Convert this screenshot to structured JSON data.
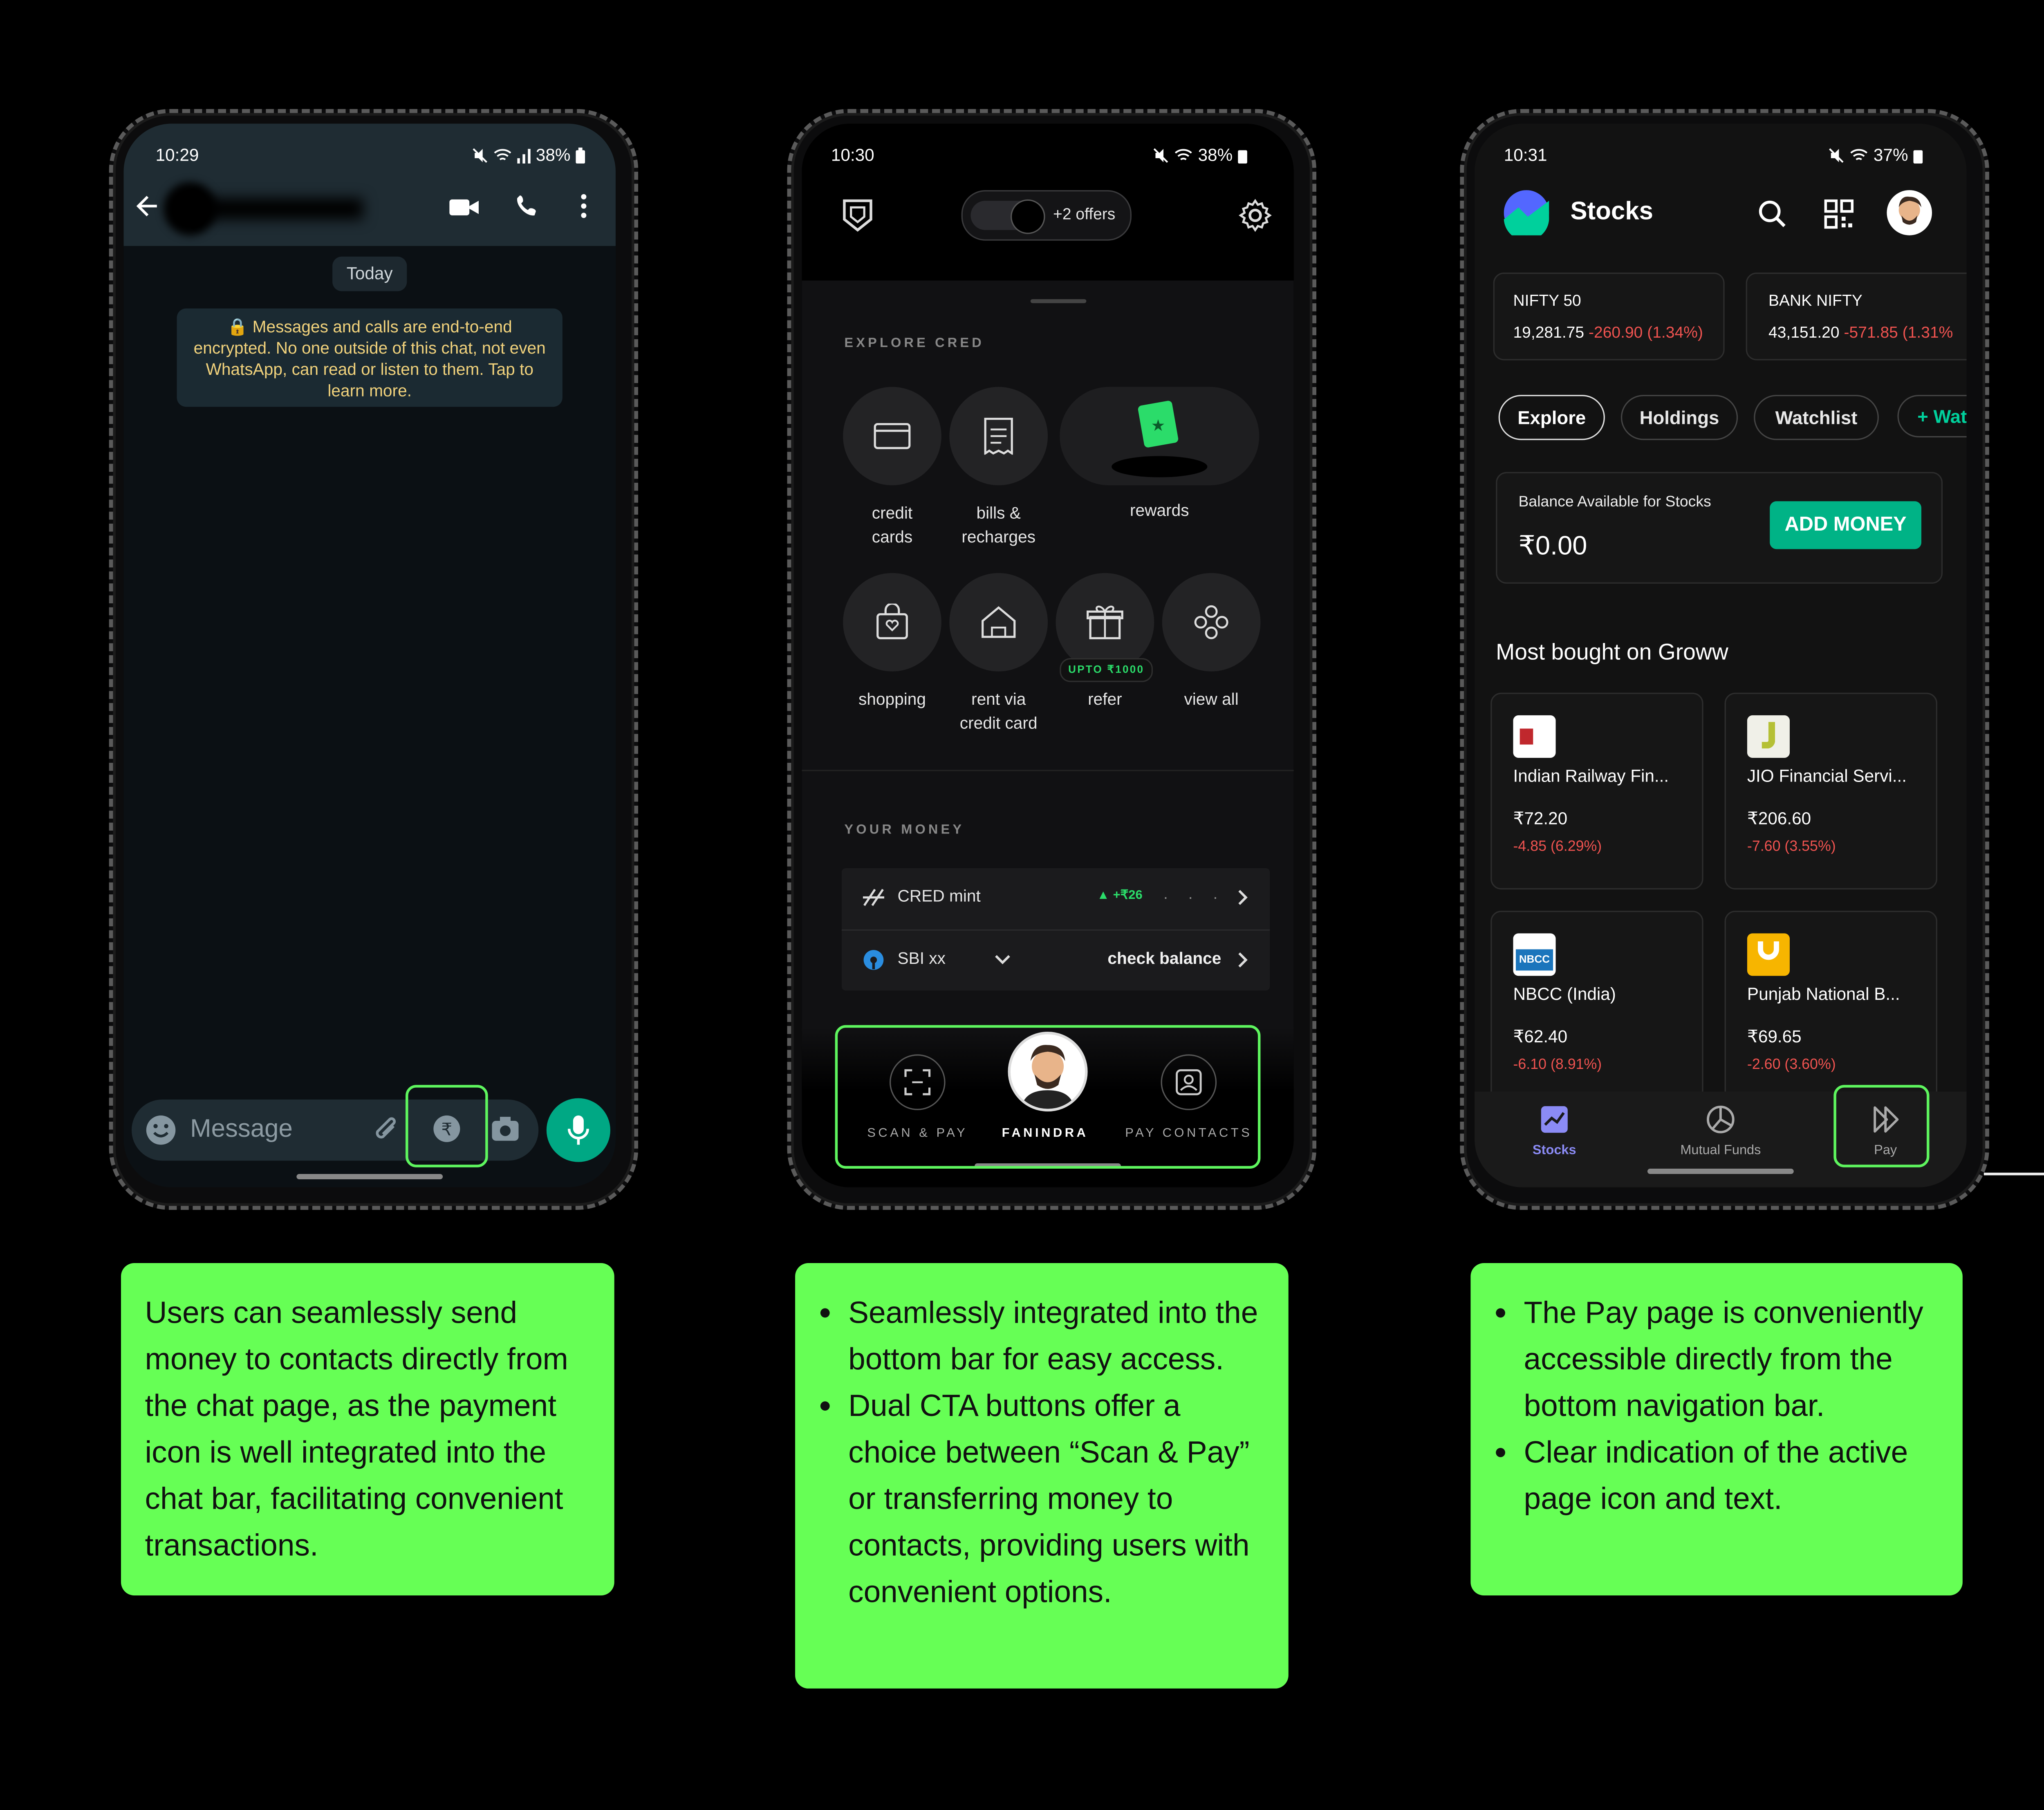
{
  "whatsapp": {
    "time": "10:29",
    "battery": "38%",
    "date_chip": "Today",
    "encryption_notice": "🔒 Messages and calls are end-to-end encrypted. No one outside of this chat, not even WhatsApp, can read or listen to them. Tap to learn more.",
    "message_placeholder": "Message",
    "icons": [
      "back-arrow-icon",
      "video-call-icon",
      "phone-icon",
      "more-vertical-icon",
      "emoji-icon",
      "attach-icon",
      "rupee-icon",
      "camera-icon",
      "mic-icon"
    ]
  },
  "cred": {
    "time": "10:30",
    "battery": "38%",
    "offers": "+2 offers",
    "explore_title": "EXPLORE CRED",
    "explore_items": [
      {
        "l1": "credit",
        "l2": "cards"
      },
      {
        "l1": "bills &",
        "l2": "recharges"
      },
      {
        "l1": "rewards",
        "l2": ""
      },
      {
        "l1": "shopping",
        "l2": ""
      },
      {
        "l1": "rent via",
        "l2": "credit card"
      },
      {
        "l1": "refer",
        "l2": ""
      },
      {
        "l1": "view all",
        "l2": ""
      }
    ],
    "refer_badge": "UPTO ₹1000",
    "your_money_title": "YOUR MONEY",
    "mint_label": "CRED mint",
    "mint_gain": "▲ +₹26",
    "sbi_label": "SBI xx",
    "check_balance": "check balance",
    "nav": {
      "scan": "SCAN & PAY",
      "center": "FANINDRA",
      "contacts": "PAY CONTACTS"
    }
  },
  "groww": {
    "time": "10:31",
    "battery": "37%",
    "title": "Stocks",
    "indices": [
      {
        "name": "NIFTY 50",
        "value": "19,281.75",
        "change": "-260.90 (1.34%)"
      },
      {
        "name": "BANK NIFTY",
        "value": "43,151.20",
        "change": "-571.85 (1.31%"
      }
    ],
    "tabs": [
      "Explore",
      "Holdings",
      "Watchlist",
      "+ Wat"
    ],
    "balance_label": "Balance Available for Stocks",
    "balance_value": "₹0.00",
    "add_money": "ADD MONEY",
    "most_bought_title": "Most bought on Groww",
    "stocks": [
      {
        "name": "Indian Railway Fin...",
        "price": "₹72.20",
        "change": "-4.85 (6.29%)"
      },
      {
        "name": "JIO Financial Servi...",
        "price": "₹206.60",
        "change": "-7.60 (3.55%)"
      },
      {
        "name": "NBCC (India)",
        "price": "₹62.40",
        "change": "-6.10 (8.91%)"
      },
      {
        "name": "Punjab National B...",
        "price": "₹69.65",
        "change": "-2.60 (3.60%)"
      }
    ],
    "nav": [
      "Stocks",
      "Mutual Funds",
      "Pay"
    ],
    "colors": {
      "accent": "#00b386",
      "negative": "#ef5350",
      "nav_active": "#8b8bf5"
    }
  },
  "notes": {
    "whatsapp": "Users can seamlessly send money to contacts directly from the chat page, as the payment icon is well integrated into the chat bar, facilitating convenient transactions.",
    "cred": [
      "Seamlessly integrated into the bottom bar for easy access.",
      "Dual CTA buttons offer a choice between “Scan & Pay” or transferring money to contacts, providing users with convenient options."
    ],
    "groww": [
      "The Pay page is conveniently accessible directly from the bottom navigation bar.",
      "Clear indication of the active page icon and text."
    ],
    "highlight_color": "#66ff55"
  }
}
